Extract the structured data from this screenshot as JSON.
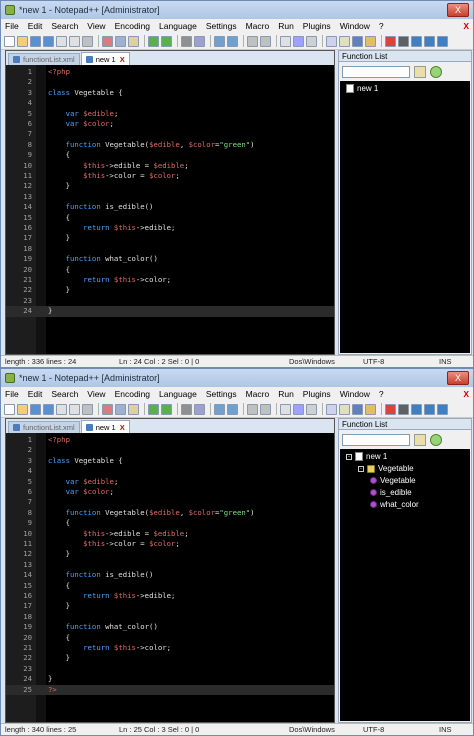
{
  "windows": [
    {
      "title": "*new 1 - Notepad++ [Administrator]",
      "close_glyph": "X",
      "menu": [
        "File",
        "Edit",
        "Search",
        "View",
        "Encoding",
        "Language",
        "Settings",
        "Macro",
        "Run",
        "Plugins",
        "Window",
        "?"
      ],
      "menu_close": "X",
      "tabs": [
        {
          "label": "functionList.xml",
          "active": false
        },
        {
          "label": "new 1",
          "active": true,
          "close": "X"
        }
      ],
      "code_lines": [
        {
          "n": "1",
          "html": "<span class='php'>&lt;?php</span>"
        },
        {
          "n": "2",
          "html": ""
        },
        {
          "n": "3",
          "html": "<span class='kw'>class</span> Vegetable {"
        },
        {
          "n": "4",
          "html": ""
        },
        {
          "n": "5",
          "html": "    <span class='kw'>var</span> <span class='var'>$edible</span>;"
        },
        {
          "n": "6",
          "html": "    <span class='kw'>var</span> <span class='var'>$color</span>;"
        },
        {
          "n": "7",
          "html": ""
        },
        {
          "n": "8",
          "html": "    <span class='kw'>function</span> Vegetable(<span class='var'>$edible</span>, <span class='var'>$color</span>=<span class='str'>\"green\"</span>)"
        },
        {
          "n": "9",
          "html": "    {"
        },
        {
          "n": "10",
          "html": "        <span class='var'>$this</span>-&gt;edible = <span class='var'>$edible</span>;"
        },
        {
          "n": "11",
          "html": "        <span class='var'>$this</span>-&gt;color = <span class='var'>$color</span>;"
        },
        {
          "n": "12",
          "html": "    }"
        },
        {
          "n": "13",
          "html": ""
        },
        {
          "n": "14",
          "html": "    <span class='kw'>function</span> is_edible()"
        },
        {
          "n": "15",
          "html": "    {"
        },
        {
          "n": "16",
          "html": "        <span class='kw'>return</span> <span class='var'>$this</span>-&gt;edible;"
        },
        {
          "n": "17",
          "html": "    }"
        },
        {
          "n": "18",
          "html": ""
        },
        {
          "n": "19",
          "html": "    <span class='kw'>function</span> what_color()"
        },
        {
          "n": "20",
          "html": "    {"
        },
        {
          "n": "21",
          "html": "        <span class='kw'>return</span> <span class='var'>$this</span>-&gt;color;"
        },
        {
          "n": "22",
          "html": "    }"
        },
        {
          "n": "23",
          "html": ""
        },
        {
          "n": "24",
          "html": "}"
        }
      ],
      "current_line": 24,
      "function_list": {
        "title": "Function List",
        "close": "X",
        "tree": [
          {
            "label": "new 1",
            "kind": "file",
            "level": 0
          }
        ]
      },
      "status": {
        "length": "length : 336   lines : 24",
        "pos": "Ln : 24   Col : 2   Sel : 0 | 0",
        "eol": "Dos\\Windows",
        "encoding": "UTF-8",
        "mode": "INS"
      }
    },
    {
      "title": "*new 1 - Notepad++ [Administrator]",
      "close_glyph": "X",
      "menu": [
        "File",
        "Edit",
        "Search",
        "View",
        "Encoding",
        "Language",
        "Settings",
        "Macro",
        "Run",
        "Plugins",
        "Window",
        "?"
      ],
      "menu_close": "X",
      "tabs": [
        {
          "label": "functionList.xml",
          "active": false
        },
        {
          "label": "new 1",
          "active": true,
          "close": "X"
        }
      ],
      "code_lines": [
        {
          "n": "1",
          "html": "<span class='php'>&lt;?php</span>"
        },
        {
          "n": "2",
          "html": ""
        },
        {
          "n": "3",
          "html": "<span class='kw'>class</span> Vegetable {"
        },
        {
          "n": "4",
          "html": ""
        },
        {
          "n": "5",
          "html": "    <span class='kw'>var</span> <span class='var'>$edible</span>;"
        },
        {
          "n": "6",
          "html": "    <span class='kw'>var</span> <span class='var'>$color</span>;"
        },
        {
          "n": "7",
          "html": ""
        },
        {
          "n": "8",
          "html": "    <span class='kw'>function</span> Vegetable(<span class='var'>$edible</span>, <span class='var'>$color</span>=<span class='str'>\"green\"</span>)"
        },
        {
          "n": "9",
          "html": "    {"
        },
        {
          "n": "10",
          "html": "        <span class='var'>$this</span>-&gt;edible = <span class='var'>$edible</span>;"
        },
        {
          "n": "11",
          "html": "        <span class='var'>$this</span>-&gt;color = <span class='var'>$color</span>;"
        },
        {
          "n": "12",
          "html": "    }"
        },
        {
          "n": "13",
          "html": ""
        },
        {
          "n": "14",
          "html": "    <span class='kw'>function</span> is_edible()"
        },
        {
          "n": "15",
          "html": "    {"
        },
        {
          "n": "16",
          "html": "        <span class='kw'>return</span> <span class='var'>$this</span>-&gt;edible;"
        },
        {
          "n": "17",
          "html": "    }"
        },
        {
          "n": "18",
          "html": ""
        },
        {
          "n": "19",
          "html": "    <span class='kw'>function</span> what_color()"
        },
        {
          "n": "20",
          "html": "    {"
        },
        {
          "n": "21",
          "html": "        <span class='kw'>return</span> <span class='var'>$this</span>-&gt;color;"
        },
        {
          "n": "22",
          "html": "    }"
        },
        {
          "n": "23",
          "html": ""
        },
        {
          "n": "24",
          "html": "}"
        },
        {
          "n": "25",
          "html": "<span class='php'>?&gt;</span>"
        }
      ],
      "current_line": 25,
      "function_list": {
        "title": "Function List",
        "close": "X",
        "tree": [
          {
            "label": "new 1",
            "kind": "file",
            "level": 0,
            "expander": "-"
          },
          {
            "label": "Vegetable",
            "kind": "class",
            "level": 1,
            "expander": "-"
          },
          {
            "label": "Vegetable",
            "kind": "func",
            "level": 2
          },
          {
            "label": "is_edible",
            "kind": "func",
            "level": 2
          },
          {
            "label": "what_color",
            "kind": "func",
            "level": 2
          }
        ]
      },
      "status": {
        "length": "length : 340   lines : 25",
        "pos": "Ln : 25   Col : 3   Sel : 0 | 0",
        "eol": "Dos\\Windows",
        "encoding": "UTF-8",
        "mode": "INS"
      }
    }
  ],
  "colors": {
    "keyword": "#4aa3ff",
    "variable": "#e06a6a",
    "string": "#7de07d",
    "editor_bg": "#000000"
  }
}
